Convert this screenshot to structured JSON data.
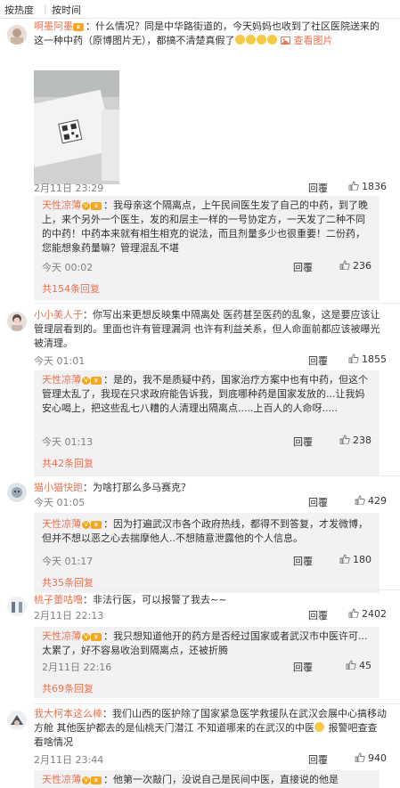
{
  "sort": {
    "hot": "按热度",
    "time": "按时间"
  },
  "colors": {
    "accent": "#eb7350",
    "sub_bg": "#f2f2f5"
  },
  "comments": [
    {
      "user": "啊墨阿墨",
      "text": "：什么情况？同是中华路街道的，今天妈妈也收到了社区医院送来的这一种中药（原博图片无），都搞不清楚真假了",
      "link": "查看图片",
      "time": "2月11日 23:29",
      "reply": "回覆",
      "likes": "1836",
      "photo_text": "一号协定方",
      "photo_text2": "请使用微信扫描二维码查看",
      "photo_text3": "武汉"
    },
    {
      "user": "天性凉薄",
      "text": "：我母亲这个隔离点，上午民间医生发了自己的中药，到了晚上，来个另外一个医生，发的和层主一样的一号协定方，一天发了二种不同的中药！中药本来就有相生相克的说法，而且剂量多少也很重要！二份药，您能想象药量嘛？管理混乱不堪",
      "time": "今天 00:02",
      "reply": "回覆",
      "likes": "236",
      "more": "共154条回复"
    },
    {
      "user": "小小美人于",
      "text": "：你写出来更想反映集中隔离处 医药甚至医药的乱象，这是要应该让管理层看到的。里面也许有管理漏洞 也许有利益关系，但人命面前都应该被曝光被清理。",
      "time": "今天 01:01",
      "reply": "回覆",
      "likes": "1855"
    },
    {
      "user": "天性凉薄",
      "text": "：是的，我不是质疑中药，国家治疗方案中也有中药，但这个管理太乱了，我现在只求政府能告诉我，到底哪种药是国家发放的...让我妈安心喝上，把这些乱七八糟的人清理出隔离点.....上百人的人命呀.....",
      "time": "今天 01:13",
      "reply": "回覆",
      "likes": "238",
      "more": "共42条回复"
    },
    {
      "user": "猫小猫快跑",
      "text": "：为啥打那么多马赛克？",
      "time": "今天 01:05",
      "reply": "回覆",
      "likes": "429"
    },
    {
      "user": "天性凉薄",
      "text": "：因为打遍武汉市各个政府热线，都得不到答复，才发微博，但并不想以恶之心去揣摩他人..不想随意泄露他的个人信息。",
      "time": "今天 01:17",
      "reply": "回覆",
      "likes": "180",
      "more": "共35条回复"
    },
    {
      "user": "桃子蕾咕噜",
      "text": "：非法行医，可以报警了我去~~",
      "time": "2月11日 22:13",
      "reply": "回覆",
      "likes": "2402"
    },
    {
      "user": "天性凉薄",
      "text": "：我只想知道他开的药方是否经过国家或者武汉市中医许可...太累了，好不容易收治到隔离点，还被折腾",
      "time": "2月11日 22:16",
      "reply": "回覆",
      "likes": "45",
      "more": "共69条回复"
    },
    {
      "user": "我大柯本这么棒",
      "text": "：我们山西的医护除了国家紧急医学救援队在武汉会展中心搞移动方舱 其他医护都去的是仙桃天门潜江 不知道哪来的在武汉的中医",
      "text2": "报警吧查查看啥情况",
      "time": "2月11日 23:44",
      "reply": "回覆",
      "likes": "940"
    },
    {
      "user": "天性凉薄",
      "text": "：他第一次敲门，没说自己是民间中医，直接说的他是"
    }
  ]
}
